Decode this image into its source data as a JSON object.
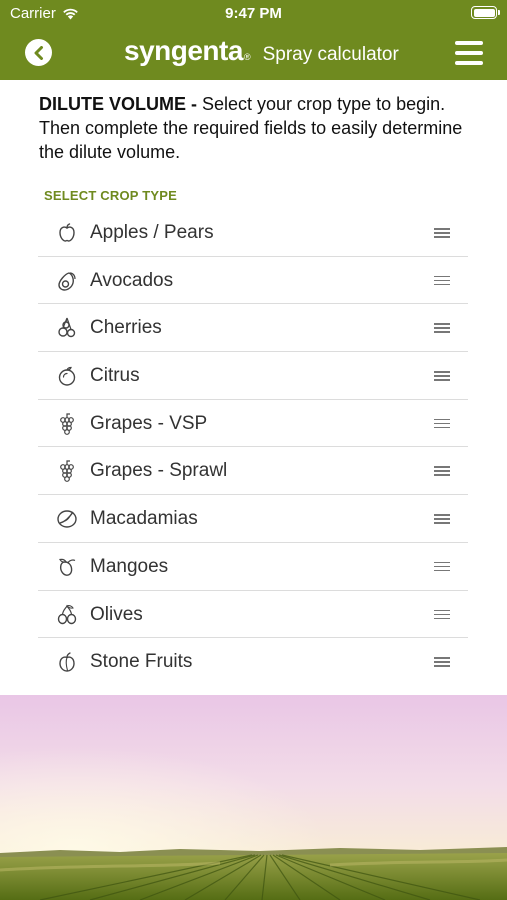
{
  "status": {
    "carrier": "Carrier",
    "time": "9:47 PM"
  },
  "header": {
    "brand": "syngenta",
    "registered": "®",
    "title": "Spray calculator"
  },
  "intro": {
    "heading": "DILUTE VOLUME -",
    "text": " Select your crop type to begin. Then complete the required fields to easily determine the dilute volume."
  },
  "section_label": "SELECT CROP TYPE",
  "crops": [
    {
      "label": "Apples / Pears",
      "icon": "apple-icon"
    },
    {
      "label": "Avocados",
      "icon": "avocado-icon"
    },
    {
      "label": "Cherries",
      "icon": "cherries-icon"
    },
    {
      "label": "Citrus",
      "icon": "citrus-icon"
    },
    {
      "label": "Grapes - VSP",
      "icon": "grapes-icon"
    },
    {
      "label": "Grapes - Sprawl",
      "icon": "grapes-icon"
    },
    {
      "label": "Macadamias",
      "icon": "macadamia-icon"
    },
    {
      "label": "Mangoes",
      "icon": "mango-icon"
    },
    {
      "label": "Olives",
      "icon": "olives-icon"
    },
    {
      "label": "Stone Fruits",
      "icon": "stone-fruit-icon"
    }
  ],
  "colors": {
    "brand_green": "#6f8a1f",
    "text": "#333333",
    "divider": "#dcdcdc"
  }
}
